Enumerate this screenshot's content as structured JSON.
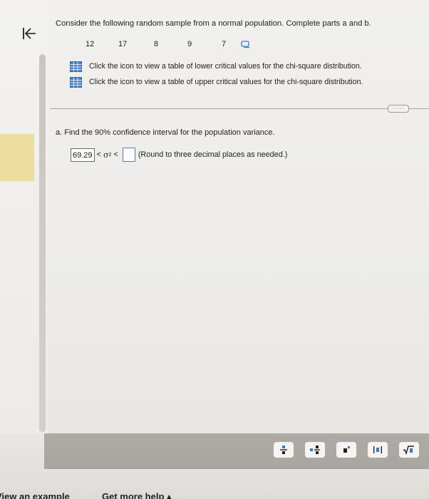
{
  "question": {
    "prompt": "Consider the following random sample from a normal population. Complete parts a and b.",
    "sample_values": [
      "12",
      "17",
      "8",
      "9",
      "7"
    ]
  },
  "links": [
    {
      "label": "Click the icon to view a table of lower critical values for the chi-square distribution.",
      "icon": "table-icon"
    },
    {
      "label": "Click the icon to view a table of upper critical values for the chi-square distribution.",
      "icon": "table-icon"
    }
  ],
  "more_pill": "·····",
  "part_a": {
    "label": "a. Find the 90% confidence interval for the population variance.",
    "lower_value": "69.29",
    "operator": "<",
    "sigma": "σ",
    "exponent": "2",
    "upper_value": "",
    "note": "(Round to three decimal places as needed.)"
  },
  "toolbar": {
    "buttons": [
      "fraction-icon",
      "mixed-number-icon",
      "exponent-icon",
      "absolute-value-icon",
      "sqrt-icon"
    ]
  },
  "bottom": {
    "view_example": "View an example",
    "get_more_help": "Get more help ▴"
  },
  "colors": {
    "accent_blue": "#3a78c2",
    "left_accent": "#eedda0",
    "toolbar_bg": "#aeaaa5"
  }
}
